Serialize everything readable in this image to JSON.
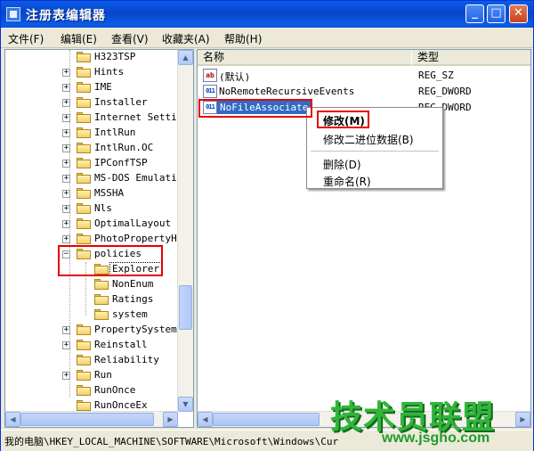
{
  "window": {
    "title": "注册表编辑器"
  },
  "title_buttons": {
    "minimize": "_",
    "maximize": "□",
    "close": "✕"
  },
  "menubar": {
    "items": [
      {
        "label": "文件(F)"
      },
      {
        "label": "编辑(E)"
      },
      {
        "label": "查看(V)"
      },
      {
        "label": "收藏夹(A)"
      },
      {
        "label": "帮助(H)"
      }
    ]
  },
  "tree": {
    "items": [
      {
        "label": "H323TSP",
        "expander": ""
      },
      {
        "label": "Hints",
        "expander": "+"
      },
      {
        "label": "IME",
        "expander": "+"
      },
      {
        "label": "Installer",
        "expander": "+"
      },
      {
        "label": "Internet Setti",
        "expander": "+"
      },
      {
        "label": "IntlRun",
        "expander": "+"
      },
      {
        "label": "IntlRun.OC",
        "expander": "+"
      },
      {
        "label": "IPConfTSP",
        "expander": "+"
      },
      {
        "label": "MS-DOS Emulati",
        "expander": "+"
      },
      {
        "label": "MSSHA",
        "expander": "+"
      },
      {
        "label": "Nls",
        "expander": "+"
      },
      {
        "label": "OptimalLayout",
        "expander": "+"
      },
      {
        "label": "PhotoPropertyH",
        "expander": "+"
      },
      {
        "label": "policies",
        "expander": "−"
      },
      {
        "label": "Explorer",
        "expander": "",
        "child": true,
        "selected": true
      },
      {
        "label": "NonEnum",
        "expander": "",
        "child": true
      },
      {
        "label": "Ratings",
        "expander": "",
        "child": true
      },
      {
        "label": "system",
        "expander": "",
        "child": true
      },
      {
        "label": "PropertySystem",
        "expander": "+"
      },
      {
        "label": "Reinstall",
        "expander": "+"
      },
      {
        "label": "Reliability",
        "expander": ""
      },
      {
        "label": "Run",
        "expander": "+"
      },
      {
        "label": "RunOnce",
        "expander": ""
      },
      {
        "label": "RunOnceEx",
        "expander": ""
      }
    ]
  },
  "list": {
    "headers": {
      "name": "名称",
      "type": "类型"
    },
    "rows": [
      {
        "icon": "string-value-icon",
        "glyph": "ab",
        "name": "(默认)",
        "type": "REG_SZ"
      },
      {
        "icon": "binary-value-icon",
        "glyph": "011",
        "name": "NoRemoteRecursiveEvents",
        "type": "REG_DWORD"
      },
      {
        "icon": "binary-value-icon",
        "glyph": "011",
        "name": "NoFileAssociate",
        "type": "REG_DWORD",
        "selected": true
      }
    ]
  },
  "context_menu": {
    "items": [
      {
        "label": "修改(M)",
        "bold": true
      },
      {
        "label": "修改二进位数据(B)"
      },
      {
        "label": "删除(D)"
      },
      {
        "label": "重命名(R)"
      }
    ]
  },
  "statusbar": {
    "path": "我的电脑\\HKEY_LOCAL_MACHINE\\SOFTWARE\\Microsoft\\Windows\\Cur"
  },
  "watermark": {
    "title": "技术员联盟",
    "url": "www.jsgho.com"
  },
  "colors": {
    "title_blue": "#0a5ce8",
    "selection": "#316ac5",
    "highlight_red": "#e60000",
    "watermark_green": "#32b53a"
  }
}
